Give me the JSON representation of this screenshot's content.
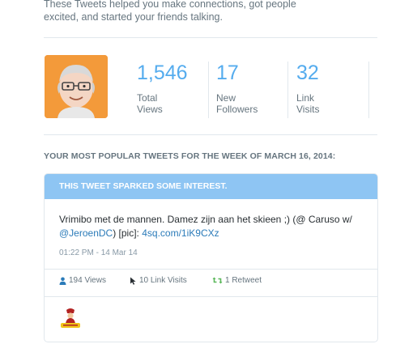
{
  "intro": {
    "line1": "These Tweets helped you make connections, got people",
    "line2": "excited, and started your friends talking."
  },
  "stats": [
    {
      "value": "1,546",
      "label_line1": "Total",
      "label_line2": "Views"
    },
    {
      "value": "17",
      "label_line1": "New",
      "label_line2": "Followers"
    },
    {
      "value": "32",
      "label_line1": "Link",
      "label_line2": "Visits"
    }
  ],
  "section_title": "YOUR MOST POPULAR TWEETS FOR THE WEEK OF MARCH 16, 2014:",
  "card": {
    "header": "THIS TWEET SPARKED SOME INTEREST.",
    "text_line1": "Vrimibo met de mannen. Damez zijn aan het skieen ;) (@ Caruso w/",
    "mention": "@JeroenDC",
    "text_mid": ") [pic]: ",
    "link": "4sq.com/1iK9CXz",
    "timestamp": "01:22 PM - 14 Mar 14",
    "views": "194 Views",
    "link_visits": "10 Link Visits",
    "retweets": "1 Retweet"
  },
  "colors": {
    "accent": "#55acee",
    "card_header": "#8ec5f3",
    "link": "#2b7bb9",
    "retweet": "#5cb85c"
  },
  "icons": [
    "avatar",
    "person-icon",
    "cursor-icon",
    "retweet-icon",
    "caruso-logo"
  ]
}
